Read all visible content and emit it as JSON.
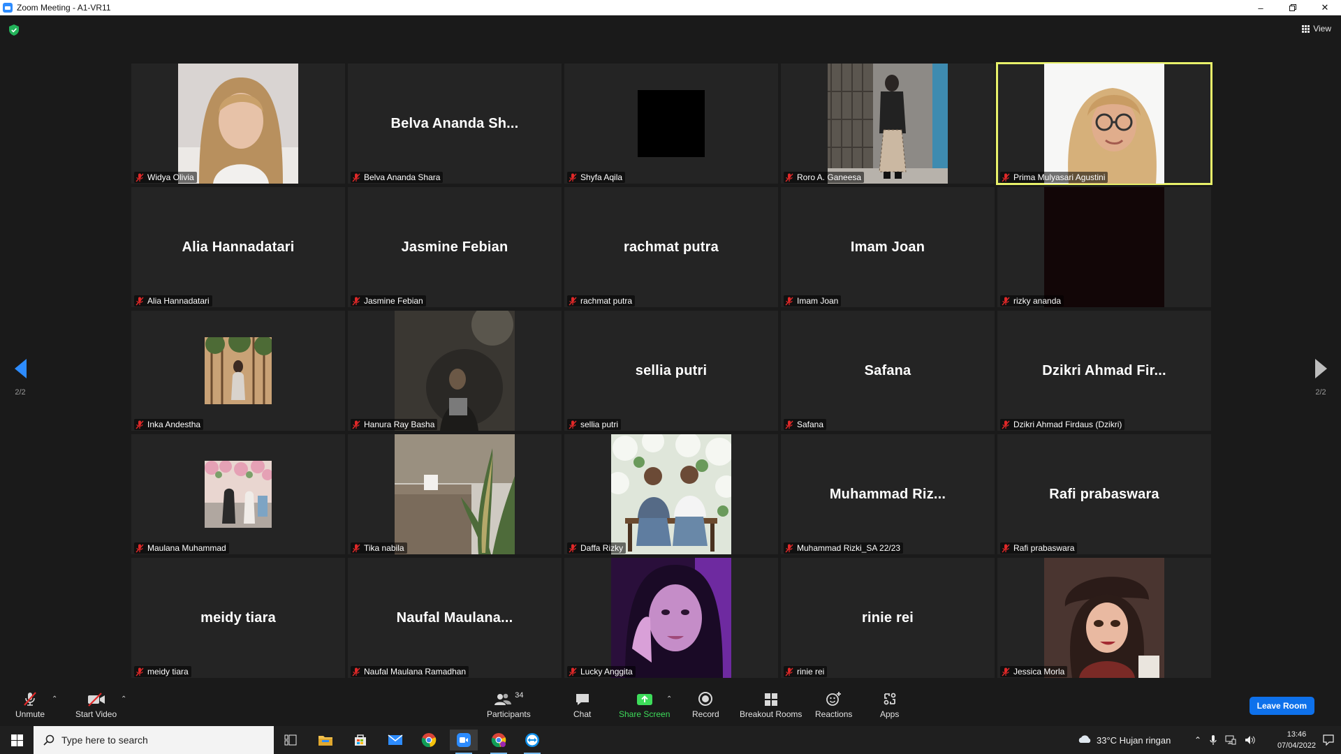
{
  "window": {
    "title": "Zoom Meeting - A1-VR11"
  },
  "topbar": {
    "view_label": "View"
  },
  "pagination": {
    "left": "2/2",
    "right": "2/2"
  },
  "tiles": [
    {
      "name": "Widya Olivia",
      "mode": "photo",
      "photo": "portrait-light"
    },
    {
      "name": "Belva Ananda Shara",
      "display": "Belva  Ananda  Sh...",
      "mode": "text"
    },
    {
      "name": "Shyfa Aqila",
      "mode": "black"
    },
    {
      "name": "Roro A. Ganeesa",
      "mode": "photo",
      "photo": "street"
    },
    {
      "name": "Prima Mulyasari Agustini",
      "mode": "photo",
      "photo": "hijab",
      "active": true
    },
    {
      "name": "Alia Hannadatari",
      "display": "Alia Hannadatari",
      "mode": "text"
    },
    {
      "name": "Jasmine Febian",
      "display": "Jasmine Febian",
      "mode": "text"
    },
    {
      "name": "rachmat putra",
      "display": "rachmat putra",
      "mode": "text"
    },
    {
      "name": "Imam Joan",
      "display": "Imam Joan",
      "mode": "text"
    },
    {
      "name": "rizky ananda",
      "mode": "darkvideo"
    },
    {
      "name": "Inka Andestha",
      "mode": "thumb",
      "photo": "forest"
    },
    {
      "name": "Hanura Ray Basha",
      "mode": "photo",
      "photo": "night"
    },
    {
      "name": "sellia putri",
      "display": "sellia putri",
      "mode": "text"
    },
    {
      "name": "Safana",
      "display": "Safana",
      "mode": "text"
    },
    {
      "name": "Dzikri Ahmad Firdaus (Dzikri)",
      "display": "Dzikri  Ahmad  Fir...",
      "mode": "text"
    },
    {
      "name": "Maulana Muhammad",
      "mode": "thumb",
      "photo": "flowers"
    },
    {
      "name": "Tika nabila",
      "mode": "photo",
      "photo": "plant"
    },
    {
      "name": "Daffa Rizky",
      "mode": "photo",
      "photo": "couple"
    },
    {
      "name": "Muhammad Rizki_SA 22/23",
      "display": "Muhammad  Riz...",
      "mode": "text"
    },
    {
      "name": "Rafi prabaswara",
      "display": "Rafi prabaswara",
      "mode": "text"
    },
    {
      "name": "meidy tiara",
      "display": "meidy tiara",
      "mode": "text"
    },
    {
      "name": "Naufal Maulana Ramadhan",
      "display": "Naufal  Maulana...",
      "mode": "text"
    },
    {
      "name": "Lucky Anggita",
      "mode": "photo",
      "photo": "purple"
    },
    {
      "name": "rinie rei",
      "display": "rinie rei",
      "mode": "text"
    },
    {
      "name": "Jessica Morla",
      "mode": "photo",
      "photo": "doll"
    }
  ],
  "controls": {
    "unmute": "Unmute",
    "start_video": "Start Video",
    "participants": "Participants",
    "participants_count": "34",
    "chat": "Chat",
    "share_screen": "Share Screen",
    "record": "Record",
    "breakout": "Breakout Rooms",
    "reactions": "Reactions",
    "apps": "Apps",
    "leave": "Leave Room"
  },
  "taskbar": {
    "search_placeholder": "Type here to search",
    "weather": "33°C  Hujan ringan",
    "time": "13:46",
    "date": "07/04/2022"
  },
  "colors": {
    "accent": "#2d8cff",
    "active_speaker": "#e8f16a",
    "share_green": "#3ddc5a",
    "leave_blue": "#0e71eb",
    "muted_red": "#e02828"
  }
}
